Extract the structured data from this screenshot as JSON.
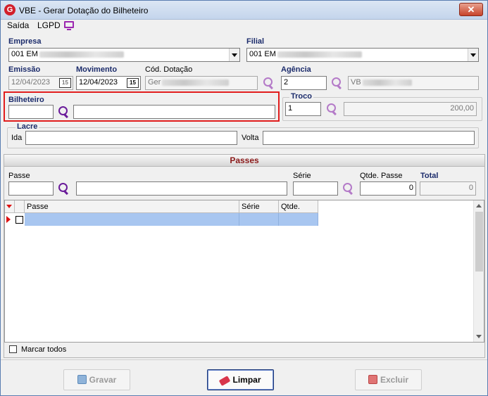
{
  "window": {
    "title": "VBE - Gerar Dotação do Bilheteiro",
    "icon": "G",
    "close_label": "✕"
  },
  "menu": {
    "items": [
      "Saída",
      "LGPD"
    ],
    "monitor_icon": "monitor-icon"
  },
  "empresa": {
    "label": "Empresa",
    "value": "001 EM"
  },
  "filial": {
    "label": "Filial",
    "value": "001 EM"
  },
  "emissao": {
    "label": "Emissão",
    "value": "12/04/2023",
    "cal": "15"
  },
  "movimento": {
    "label": "Movimento",
    "value": "12/04/2023",
    "cal": "15"
  },
  "cod_dotacao": {
    "label": "Cód. Dotação",
    "value": "Ger"
  },
  "agencia": {
    "label": "Agência",
    "code": "2",
    "name": "VB"
  },
  "bilheteiro": {
    "label": "Bilheteiro",
    "code": "",
    "name": ""
  },
  "troco": {
    "label": "Troco",
    "code": "1",
    "value": "200,00"
  },
  "lacre": {
    "label": "Lacre",
    "ida_label": "Ida",
    "ida_value": "",
    "volta_label": "Volta",
    "volta_value": ""
  },
  "passes": {
    "section_title": "Passes",
    "passe_label": "Passe",
    "serie_label": "Série",
    "qtde_label": "Qtde. Passe",
    "qtde_value": "0",
    "total_label": "Total",
    "total_value": "0",
    "grid": {
      "columns": [
        "Passe",
        "Série",
        "Qtde."
      ],
      "rows": [
        {
          "passe": "",
          "serie": "",
          "qtde": ""
        }
      ]
    },
    "marcar_todos_label": "Marcar todos"
  },
  "buttons": {
    "gravar": {
      "label": "Gravar"
    },
    "limpar": {
      "label": "Limpar"
    },
    "excluir": {
      "label": "Excluir"
    }
  },
  "colors": {
    "highlight": "#e11d1d",
    "accent": "#6a1b9a",
    "section_title": "#8b1a1a"
  }
}
